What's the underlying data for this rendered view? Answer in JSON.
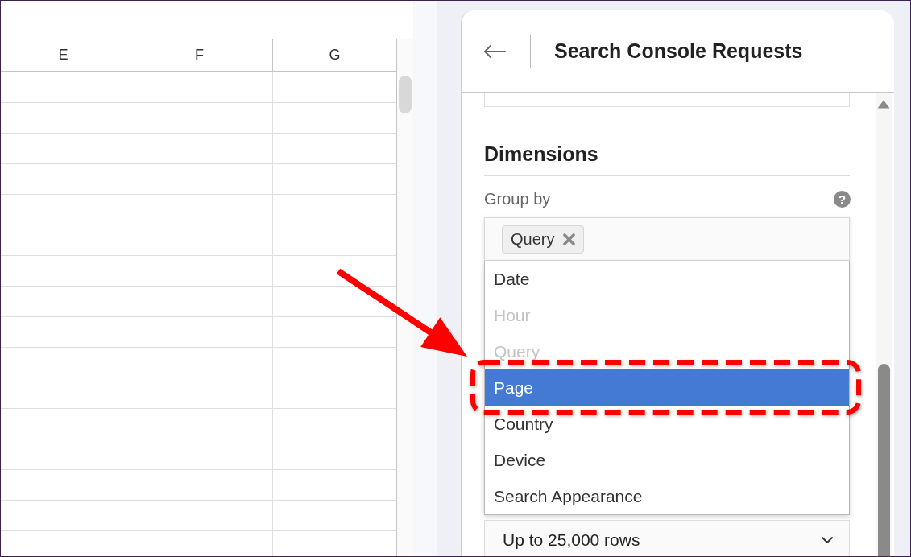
{
  "spreadsheet": {
    "columns": [
      {
        "label": "E"
      },
      {
        "label": "F"
      },
      {
        "label": "G"
      }
    ]
  },
  "panel": {
    "title": "Search Console Requests"
  },
  "dimensions": {
    "heading": "Dimensions",
    "group_by": {
      "label": "Group by",
      "help": "?",
      "chips": [
        {
          "label": "Query"
        }
      ],
      "options": [
        {
          "label": "Date",
          "disabled": false,
          "selected": false
        },
        {
          "label": "Hour",
          "disabled": true,
          "selected": false
        },
        {
          "label": "Query",
          "disabled": true,
          "selected": false
        },
        {
          "label": "Page",
          "disabled": false,
          "selected": true
        },
        {
          "label": "Country",
          "disabled": false,
          "selected": false
        },
        {
          "label": "Device",
          "disabled": false,
          "selected": false
        },
        {
          "label": "Search Appearance",
          "disabled": false,
          "selected": false
        }
      ]
    }
  },
  "row_limit": {
    "value": "Up to 25,000 rows"
  }
}
